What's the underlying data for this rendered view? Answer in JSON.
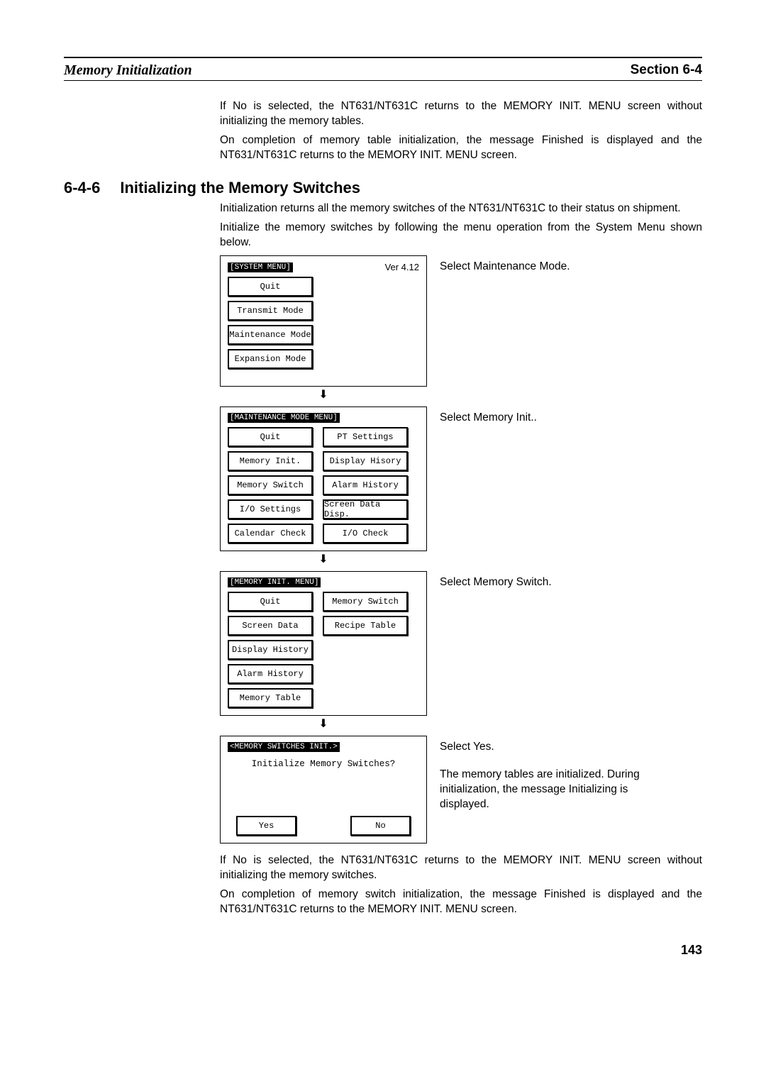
{
  "header": {
    "left": "Memory Initialization",
    "right": "Section 6-4"
  },
  "intro": {
    "p1": "If No is selected, the NT631/NT631C returns to the MEMORY INIT. MENU screen without initializing the memory tables.",
    "p2": "On completion of memory table initialization, the message Finished is displayed and the NT631/NT631C returns to the MEMORY INIT. MENU screen."
  },
  "section": {
    "num": "6-4-6",
    "title": "Initializing the Memory Switches",
    "p1": "Initialization returns all the memory switches of the NT631/NT631C to their status on shipment.",
    "p2": "Initialize the memory switches by following the menu operation from the System Menu shown below."
  },
  "panel1": {
    "title": "[SYSTEM MENU]",
    "ver": "Ver 4.12",
    "b1": "Quit",
    "b2": "Transmit Mode",
    "b3": "Maintenance Mode",
    "b4": "Expansion Mode",
    "side": "Select Maintenance Mode."
  },
  "panel2": {
    "title": "[MAINTENANCE MODE MENU]",
    "l1": "Quit",
    "r1": "PT Settings",
    "l2": "Memory Init.",
    "r2": "Display Hisory",
    "l3": "Memory Switch",
    "r3": "Alarm History",
    "l4": "I/O Settings",
    "r4": "Screen Data Disp.",
    "l5": "Calendar Check",
    "r5": "I/O Check",
    "side": "Select Memory Init.."
  },
  "panel3": {
    "title": "[MEMORY INIT. MENU]",
    "l1": "Quit",
    "r1": "Memory Switch",
    "l2": "Screen Data",
    "r2": "Recipe Table",
    "l3": "Display History",
    "l4": "Alarm History",
    "l5": "Memory Table",
    "side": "Select Memory Switch."
  },
  "panel4": {
    "title": "<MEMORY SWITCHES INIT.>",
    "msg": "Initialize Memory Switches?",
    "yes": "Yes",
    "no": "No",
    "side1": "Select Yes.",
    "side2": "The memory tables are initialized. During initialization, the message Initializing is displayed."
  },
  "outro": {
    "p1": "If No is selected, the NT631/NT631C returns to the MEMORY INIT. MENU screen without initializing the memory switches.",
    "p2": "On completion of memory switch initialization, the message Finished is displayed and the NT631/NT631C returns to the MEMORY INIT. MENU screen."
  },
  "pagenum": "143"
}
